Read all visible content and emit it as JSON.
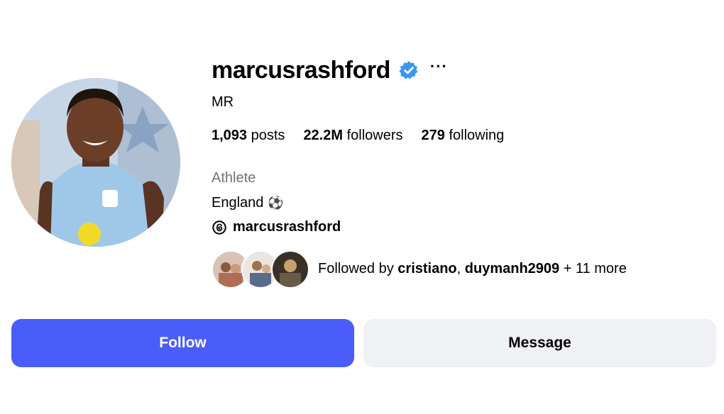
{
  "profile": {
    "username": "marcusrashford",
    "full_name": "MR",
    "category": "Athlete",
    "bio_line": "England",
    "bio_emoji": "⚽",
    "threads_handle": "marcusrashford",
    "more_label": "···"
  },
  "stats": {
    "posts_count": "1,093",
    "posts_label": "posts",
    "followers_count": "22.2M",
    "followers_label": "followers",
    "following_count": "279",
    "following_label": "following"
  },
  "followed_by": {
    "prefix": "Followed by ",
    "user1": "cristiano",
    "separator": ", ",
    "user2": "duymanh2909",
    "suffix": " + 11 more"
  },
  "actions": {
    "follow_label": "Follow",
    "message_label": "Message"
  },
  "colors": {
    "accent": "#4a5df9",
    "verified": "#3897f0",
    "secondary_text": "#737373",
    "message_bg": "#eff1f4"
  },
  "icons": {
    "verified": "verified-badge-icon",
    "threads": "threads-icon",
    "more": "more-options-icon"
  }
}
